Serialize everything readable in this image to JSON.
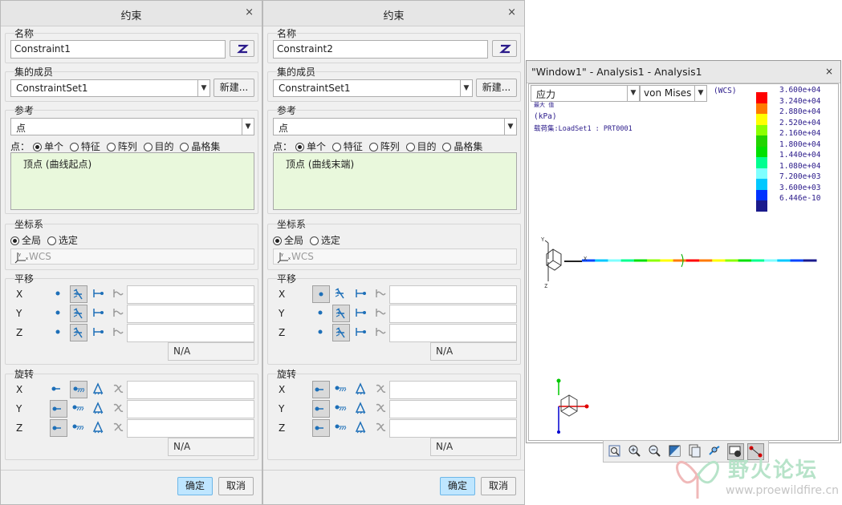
{
  "dialog_left": {
    "title": "约束",
    "close": "×",
    "name_label": "名称",
    "name_value": "Constraint1",
    "member_label": "集的成员",
    "member_value": "ConstraintSet1",
    "new_button": "新建...",
    "ref_label": "参考",
    "ref_type": "点",
    "point_prefix": "点：",
    "point_options": [
      "单个",
      "特征",
      "阵列",
      "目的",
      "晶格集"
    ],
    "ref_item": "顶点 (曲线起点)",
    "coord_label": "坐标系",
    "coord_options": [
      "全局",
      "选定"
    ],
    "coord_value": "WCS",
    "translate_label": "平移",
    "rotate_label": "旋转",
    "axes": [
      "X",
      "Y",
      "Z"
    ],
    "na": "N/A",
    "ok": "确定",
    "cancel": "取消"
  },
  "dialog_right": {
    "title": "约束",
    "close": "×",
    "name_label": "名称",
    "name_value": "Constraint2",
    "member_label": "集的成员",
    "member_value": "ConstraintSet1",
    "new_button": "新建...",
    "ref_label": "参考",
    "ref_type": "点",
    "point_prefix": "点：",
    "point_options": [
      "单个",
      "特征",
      "阵列",
      "目的",
      "晶格集"
    ],
    "ref_item": "顶点 (曲线末端)",
    "coord_label": "坐标系",
    "coord_options": [
      "全局",
      "选定"
    ],
    "coord_value": "WCS",
    "translate_label": "平移",
    "rotate_label": "旋转",
    "axes": [
      "X",
      "Y",
      "Z"
    ],
    "na": "N/A",
    "ok": "确定",
    "cancel": "取消"
  },
  "analysis": {
    "title": "\"Window1\" - Analysis1 - Analysis1",
    "close": "×",
    "quantity": "应力",
    "component": "von Mises",
    "wcs": "(WCS)",
    "max_label": "最大 值",
    "unit": "(kPa)",
    "loadset": "载荷集:LoadSet1  :  PRT0001",
    "legend_values": [
      "3.600e+04",
      "3.240e+04",
      "2.880e+04",
      "2.520e+04",
      "2.160e+04",
      "1.800e+04",
      "1.440e+04",
      "1.080e+04",
      "7.200e+03",
      "3.600e+03",
      "6.446e-10"
    ],
    "legend_colors": [
      "#ff0000",
      "#ff7a00",
      "#ffff00",
      "#8cff00",
      "#22d400",
      "#00e000",
      "#00ff90",
      "#7fffff",
      "#00c8ff",
      "#0033ff",
      "#1a1a8c"
    ],
    "beam_colors": [
      "#0044ff",
      "#00c8ff",
      "#7fffff",
      "#00ff90",
      "#00e000",
      "#8cff00",
      "#ffff00",
      "#ff7a00",
      "#ff0000",
      "#ff7a00",
      "#ffff00",
      "#8cff00",
      "#00e000",
      "#00ff90",
      "#7fffff",
      "#00c8ff",
      "#0044ff",
      "#1a1a8c"
    ],
    "triad_labels": {
      "y": "Y",
      "x": "X",
      "z": "Z"
    }
  },
  "watermark": {
    "text": "野火论坛",
    "url": "www.proewildfire.cn"
  }
}
